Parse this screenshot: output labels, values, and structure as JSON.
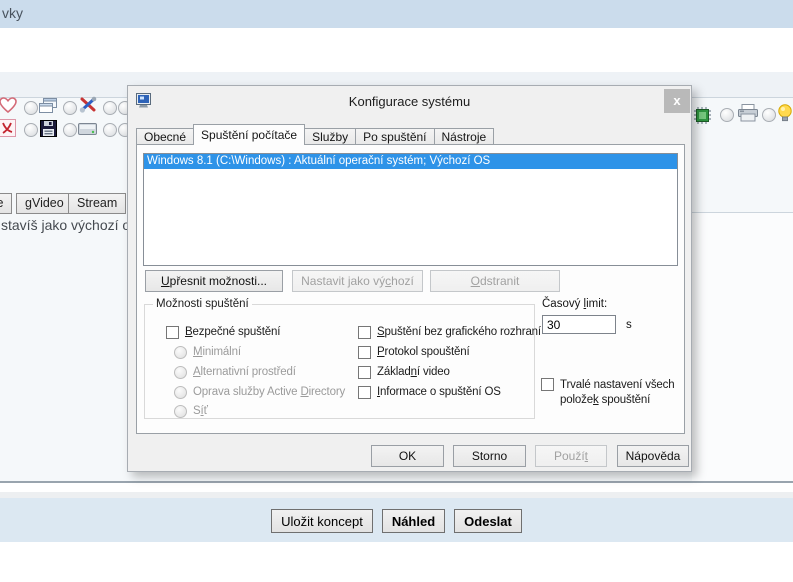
{
  "page": {
    "topbar_text": "vky",
    "editor_buttons": {
      "b1": "e",
      "b2": "gVideo",
      "b3": "Stream"
    },
    "background_text": "stavíš jako výchozí o",
    "left_icons": [
      "heart-icon",
      "windows-stack-icon",
      "tools-icon",
      "pdf-icon",
      "floppy-icon",
      "harddisk-icon"
    ],
    "right_icons": [
      "chip-icon",
      "printer-icon",
      "bulb-icon"
    ],
    "footer_buttons": {
      "draft": "Uložit koncept",
      "preview": "Náhled",
      "submit": "Odeslat"
    }
  },
  "dialog": {
    "title": "Konfigurace systému",
    "close": "x",
    "icon": "system-config-icon",
    "tabs": [
      {
        "label": "Obecné",
        "active": false
      },
      {
        "label": "Spuštění počítače",
        "active": true
      },
      {
        "label": "Služby",
        "active": false
      },
      {
        "label": "Po spuštění",
        "active": false
      },
      {
        "label": "Nástroje",
        "active": false
      }
    ],
    "boot_list": [
      {
        "label": "Windows 8.1 (C:\\Windows) : Aktuální operační systém; Výchozí OS",
        "selected": true
      }
    ],
    "list_buttons": {
      "advanced": {
        "pre": "",
        "key": "U",
        "post": "přesnit možnosti...",
        "enabled": true
      },
      "set_default": {
        "pre": "Nastavit jako vý",
        "key": "c",
        "post": "hozí",
        "enabled": false
      },
      "delete": {
        "pre": "",
        "key": "O",
        "post": "dstranit",
        "enabled": false
      }
    },
    "group": {
      "label": "Možnosti spuštění",
      "safe_boot": {
        "pre": "",
        "key": "B",
        "post": "ezpečné spuštění",
        "checked": false
      },
      "radios": [
        {
          "pre": "",
          "key": "M",
          "post": "inimální",
          "enabled": false
        },
        {
          "pre": "",
          "key": "A",
          "post": "lternativní prostředí",
          "enabled": false
        },
        {
          "pre": "Oprava služby Active ",
          "key": "D",
          "post": "irectory",
          "enabled": false
        },
        {
          "pre": "S",
          "key": "í",
          "post": "ť",
          "enabled": false
        }
      ],
      "checkboxes": [
        {
          "pre": "",
          "key": "S",
          "post": "puštění bez grafického rozhraní",
          "checked": false
        },
        {
          "pre": "",
          "key": "P",
          "post": "rotokol spouštění",
          "checked": false
        },
        {
          "pre": "Základ",
          "key": "n",
          "post": "í video",
          "checked": false
        },
        {
          "pre": "",
          "key": "I",
          "post": "nformace o spuštění OS",
          "checked": false
        }
      ]
    },
    "timeout": {
      "pre": "Časový ",
      "key": "l",
      "post": "imit:",
      "value": "30",
      "unit": "s"
    },
    "persist": {
      "line1": "Trvalé nastavení všech",
      "line2_pre": "polože",
      "line2_key": "k",
      "line2_post": " spouštění",
      "checked": false
    },
    "footer_buttons": {
      "ok": {
        "label": "OK",
        "enabled": true
      },
      "cancel": {
        "label": "Storno",
        "enabled": true
      },
      "apply": {
        "pre": "Použí",
        "key": "t",
        "post": "",
        "enabled": false
      },
      "help": {
        "label": "Nápověda",
        "enabled": true
      }
    }
  },
  "colors": {
    "topbar": "#cbdcec",
    "selection": "#2e93e8",
    "footer_bar": "#dce8f2",
    "dialog_bg": "#f0f0f0"
  }
}
